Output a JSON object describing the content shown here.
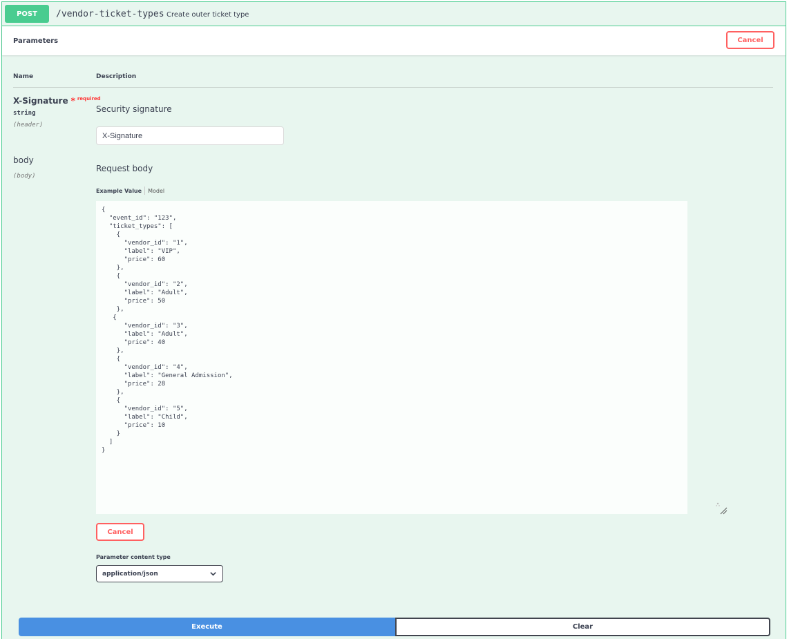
{
  "operation": {
    "method": "POST",
    "path": "/vendor-ticket-types",
    "summary": "Create outer ticket type"
  },
  "parameters_section": {
    "title": "Parameters",
    "cancel_label": "Cancel",
    "columns": {
      "name": "Name",
      "description": "Description"
    }
  },
  "params": [
    {
      "name": "X-Signature",
      "required_mark": "*",
      "required_label": "required",
      "type": "string",
      "in": "(header)",
      "description": "Security signature",
      "input_value": "X-Signature"
    },
    {
      "name": "body",
      "in": "(body)",
      "description": "Request body"
    }
  ],
  "body_tabs": {
    "example": "Example Value",
    "model": "Model"
  },
  "request_body": "{\n  \"event_id\": \"123\",\n  \"ticket_types\": [\n    {\n      \"vendor_id\": \"1\",\n      \"label\": \"VIP\",\n      \"price\": 60\n    },\n    {\n      \"vendor_id\": \"2\",\n      \"label\": \"Adult\",\n      \"price\": 50\n    },\n   {\n      \"vendor_id\": \"3\",\n      \"label\": \"Adult\",\n      \"price\": 40\n    },\n    {\n      \"vendor_id\": \"4\",\n      \"label\": \"General Admission\",\n      \"price\": 28\n    },\n    {\n      \"vendor_id\": \"5\",\n      \"label\": \"Child\",\n      \"price\": 10\n    }\n  ]\n}",
  "body_cancel_label": "Cancel",
  "content_type": {
    "label": "Parameter content type",
    "selected": "application/json"
  },
  "actions": {
    "execute": "Execute",
    "clear": "Clear"
  },
  "colors": {
    "post_green": "#49cc90",
    "panel_bg": "#e8f6ef",
    "cancel_red": "#ff6060",
    "execute_blue": "#4990e2"
  }
}
